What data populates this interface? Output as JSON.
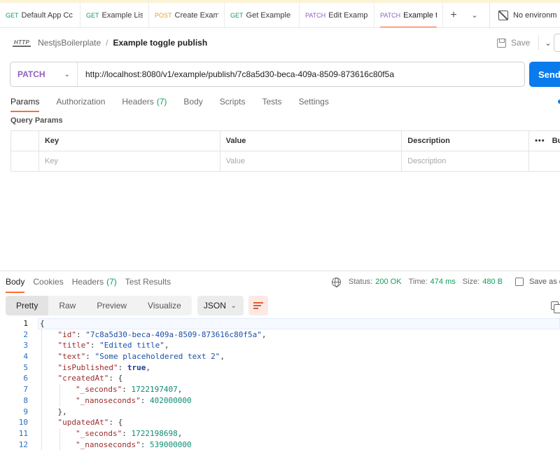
{
  "tabs": [
    {
      "method": "GET",
      "title": "Default App Cc",
      "active": false
    },
    {
      "method": "GET",
      "title": "Example List",
      "active": false
    },
    {
      "method": "POST",
      "title": "Create Examp",
      "active": false
    },
    {
      "method": "GET",
      "title": "Get Example B",
      "active": false
    },
    {
      "method": "PATCH",
      "title": "Edit Example",
      "active": false
    },
    {
      "method": "PATCH",
      "title": "Example tog",
      "active": true
    }
  ],
  "tab_tools": {
    "add": "+",
    "more": "⌄"
  },
  "environment": "No environm",
  "breadcrumb": {
    "icon_text": "HTTP",
    "parent": "NestjsBoilerplate",
    "separator": "/",
    "current": "Example toggle publish"
  },
  "save": {
    "label": "Save"
  },
  "request": {
    "method": "PATCH",
    "url": "http://localhost:8080/v1/example/publish/7c8a5d30-beca-409a-8509-873616c80f5a",
    "send_label": "Send"
  },
  "request_tabs": [
    {
      "label": "Params",
      "count": "",
      "active": true
    },
    {
      "label": "Authorization",
      "count": "",
      "active": false
    },
    {
      "label": "Headers",
      "count": "(7)",
      "active": false
    },
    {
      "label": "Body",
      "count": "",
      "active": false
    },
    {
      "label": "Scripts",
      "count": "",
      "active": false
    },
    {
      "label": "Tests",
      "count": "",
      "active": false
    },
    {
      "label": "Settings",
      "count": "",
      "active": false
    }
  ],
  "query_params": {
    "title": "Query Params",
    "columns": {
      "key": "Key",
      "value": "Value",
      "description": "Description",
      "bulk": "Bu"
    },
    "placeholders": {
      "key": "Key",
      "value": "Value",
      "description": "Description"
    }
  },
  "response_tabs": [
    {
      "label": "Body",
      "count": "",
      "active": true
    },
    {
      "label": "Cookies",
      "count": "",
      "active": false
    },
    {
      "label": "Headers",
      "count": "(7)",
      "active": false
    },
    {
      "label": "Test Results",
      "count": "",
      "active": false
    }
  ],
  "status": {
    "status_label": "Status:",
    "status_value": "200 OK",
    "time_label": "Time:",
    "time_value": "474 ms",
    "size_label": "Size:",
    "size_value": "480 B",
    "save_as": "Save as exa"
  },
  "formats": [
    {
      "label": "Pretty",
      "active": true
    },
    {
      "label": "Raw",
      "active": false
    },
    {
      "label": "Preview",
      "active": false
    },
    {
      "label": "Visualize",
      "active": false
    }
  ],
  "language": "JSON",
  "colors": {
    "accent": "#ff6c37",
    "send": "#097bed",
    "patch": "#8f5fc1",
    "get": "#0f9d58",
    "post": "#e0a32e",
    "ok": "#0f9d58"
  },
  "code_lines": [
    {
      "n": "1",
      "indent": 0,
      "parts": [
        [
          "p",
          "{"
        ]
      ]
    },
    {
      "n": "2",
      "indent": 1,
      "parts": [
        [
          "k",
          "\"id\""
        ],
        [
          "p",
          ": "
        ],
        [
          "s",
          "\"7c8a5d30-beca-409a-8509-873616c80f5a\""
        ],
        [
          "p",
          ","
        ]
      ]
    },
    {
      "n": "3",
      "indent": 1,
      "parts": [
        [
          "k",
          "\"title\""
        ],
        [
          "p",
          ": "
        ],
        [
          "s",
          "\"Edited title\""
        ],
        [
          "p",
          ","
        ]
      ]
    },
    {
      "n": "4",
      "indent": 1,
      "parts": [
        [
          "k",
          "\"text\""
        ],
        [
          "p",
          ": "
        ],
        [
          "s",
          "\"Some placeholdered text 2\""
        ],
        [
          "p",
          ","
        ]
      ]
    },
    {
      "n": "5",
      "indent": 1,
      "parts": [
        [
          "k",
          "\"isPublished\""
        ],
        [
          "p",
          ": "
        ],
        [
          "b",
          "true"
        ],
        [
          "p",
          ","
        ]
      ]
    },
    {
      "n": "6",
      "indent": 1,
      "parts": [
        [
          "k",
          "\"createdAt\""
        ],
        [
          "p",
          ": {"
        ]
      ]
    },
    {
      "n": "7",
      "indent": 2,
      "parts": [
        [
          "k",
          "\"_seconds\""
        ],
        [
          "p",
          ": "
        ],
        [
          "n",
          "1722197407"
        ],
        [
          "p",
          ","
        ]
      ]
    },
    {
      "n": "8",
      "indent": 2,
      "parts": [
        [
          "k",
          "\"_nanoseconds\""
        ],
        [
          "p",
          ": "
        ],
        [
          "n",
          "402000000"
        ]
      ]
    },
    {
      "n": "9",
      "indent": 1,
      "parts": [
        [
          "p",
          "},"
        ]
      ]
    },
    {
      "n": "10",
      "indent": 1,
      "parts": [
        [
          "k",
          "\"updatedAt\""
        ],
        [
          "p",
          ": {"
        ]
      ]
    },
    {
      "n": "11",
      "indent": 2,
      "parts": [
        [
          "k",
          "\"_seconds\""
        ],
        [
          "p",
          ": "
        ],
        [
          "n",
          "1722198698"
        ],
        [
          "p",
          ","
        ]
      ]
    },
    {
      "n": "12",
      "indent": 2,
      "parts": [
        [
          "k",
          "\"_nanoseconds\""
        ],
        [
          "p",
          ": "
        ],
        [
          "n",
          "539000000"
        ]
      ]
    }
  ]
}
